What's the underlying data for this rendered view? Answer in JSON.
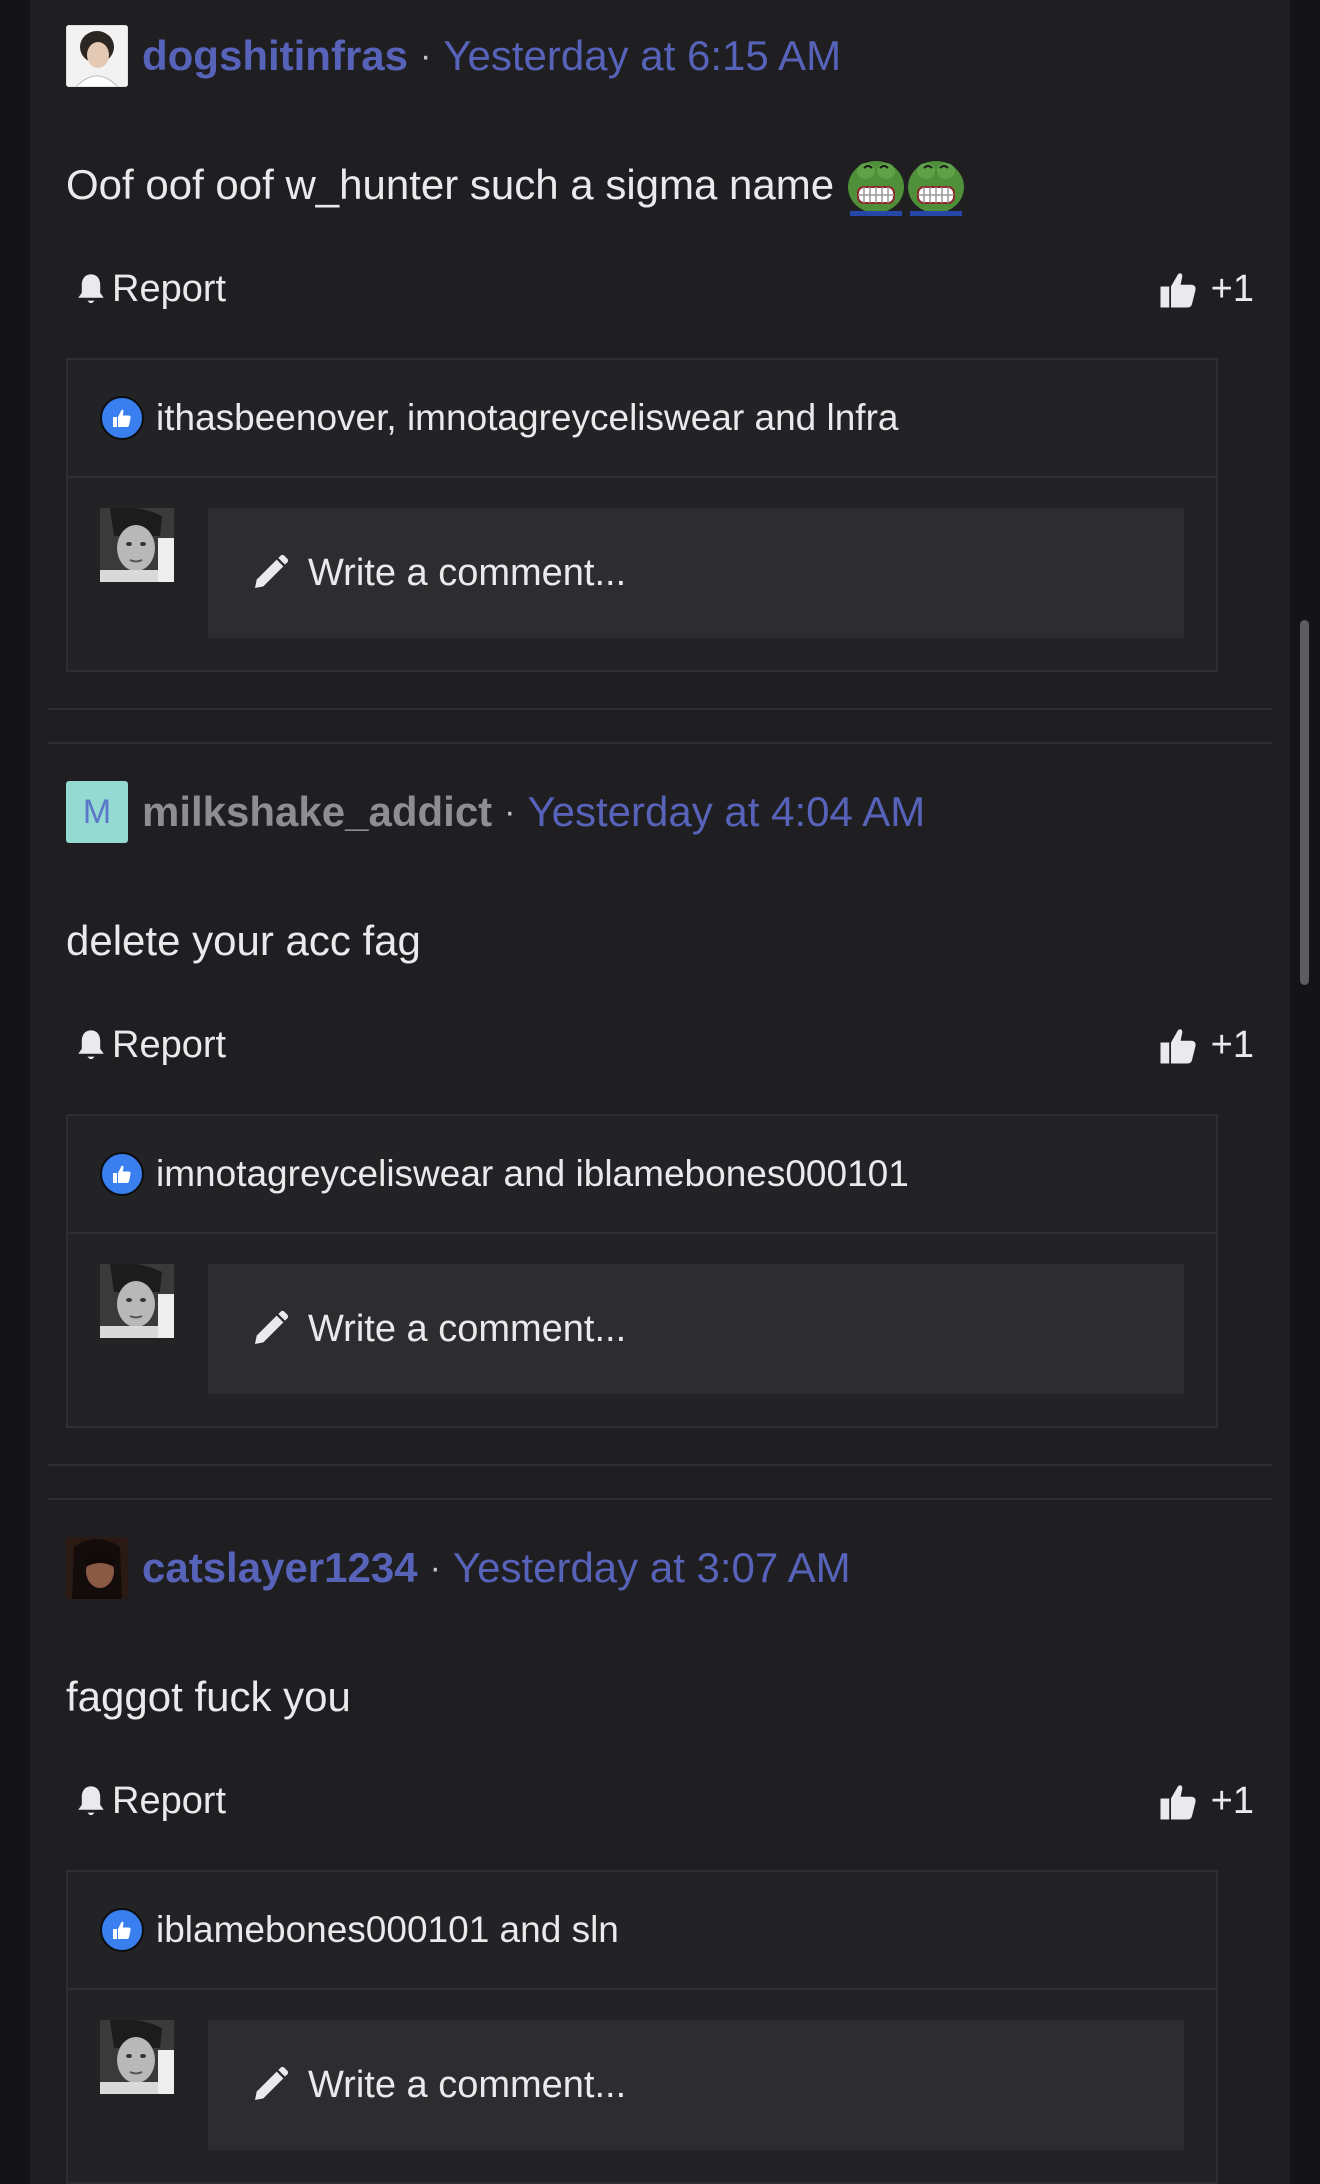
{
  "posts": [
    {
      "username": "dogshitinfras",
      "timestamp": "Yesterday at 6:15 AM",
      "body": "Oof oof oof w_hunter such a sigma name",
      "report_label": "Report",
      "like_label": "+1",
      "likers": "ithasbeenover, imnotagreyceliswear and lnfra",
      "comment_placeholder": "Write a comment..."
    },
    {
      "username": "milkshake_addict",
      "avatar_letter": "M",
      "timestamp": "Yesterday at 4:04 AM",
      "body": "delete your acc fag",
      "report_label": "Report",
      "like_label": "+1",
      "likers": "imnotagreyceliswear and iblamebones000101",
      "comment_placeholder": "Write a comment..."
    },
    {
      "username": "catslayer1234",
      "timestamp": "Yesterday at 3:07 AM",
      "body": "faggot fuck you",
      "report_label": "Report",
      "like_label": "+1",
      "likers": "iblamebones000101 and sln",
      "comment_placeholder": "Write a comment..."
    }
  ],
  "separator": "·",
  "icons": {
    "report": "bell-icon",
    "like": "thumbs-up-icon",
    "comment": "pencil-icon",
    "emoji": "laughing-frog-emoji"
  },
  "colors": {
    "background": "#1f1f22",
    "link": "#5762b9",
    "text": "#eaeaec",
    "input": "#2d2d30",
    "like_badge": "#3a7ff0",
    "letter_avatar_bg": "#94d9d2"
  }
}
